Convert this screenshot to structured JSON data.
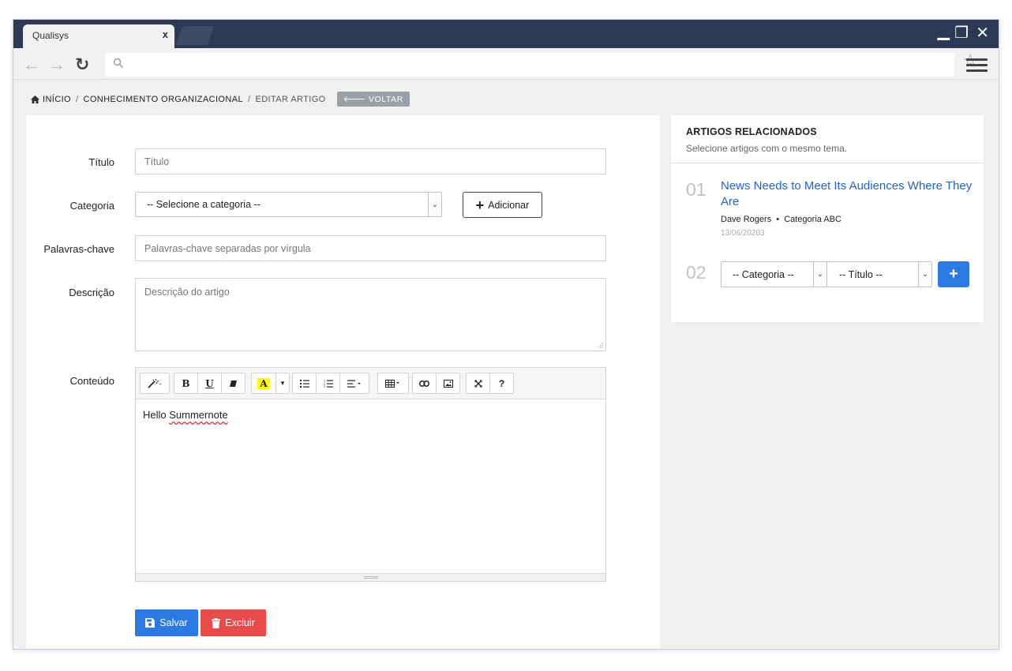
{
  "browser": {
    "tab_title": "Qualisys",
    "tab_close": "x",
    "minimize": "▁",
    "restore": "❐",
    "close": "✕",
    "back": "←",
    "forward": "→",
    "reload": "↻",
    "url_value": "",
    "bookmark": "☆"
  },
  "breadcrumb": {
    "home": "INÍCIO",
    "section": "CONHECIMENTO ORGANIZACIONAL",
    "current": "EDITAR ARTIGO",
    "separator": "/",
    "back_button": "VOLTAR"
  },
  "form": {
    "title_label": "Título",
    "title_placeholder": "Título",
    "category_label": "Categoria",
    "category_selected": "-- Selecione a categoria --",
    "add_button": "Adicionar",
    "keywords_label": "Palavras-chave",
    "keywords_placeholder": "Palavras-chave separadas por vírgula",
    "description_label": "Descrição",
    "description_placeholder": "Descrição do artigo",
    "content_label": "Conteúdo",
    "content_text_plain": "Hello ",
    "content_text_misspelled": "Summernote",
    "save_button": "Salvar",
    "delete_button": "Excluir"
  },
  "toolbar": {
    "bold": "B",
    "underline": "U",
    "color": "A",
    "help": "?"
  },
  "related": {
    "title": "ARTIGOS RELACIONADOS",
    "subtitle": "Selecione artigos com o mesmo tema.",
    "items": [
      {
        "number": "01",
        "title": "News Needs to Meet Its Audiences Where They Are",
        "author": "Dave Rogers",
        "bullet": "•",
        "category": "Categoria ABC",
        "date": "13/06/20203"
      }
    ],
    "new_item": {
      "number": "02",
      "category_select": "-- Categoria --",
      "title_select": "-- Título --",
      "add_button": "+"
    }
  },
  "colors": {
    "titlebar": "#2e3a55",
    "primary": "#2b7ae4",
    "danger": "#e94b4b",
    "link": "#2464c8",
    "highlight": "#ffff00"
  }
}
